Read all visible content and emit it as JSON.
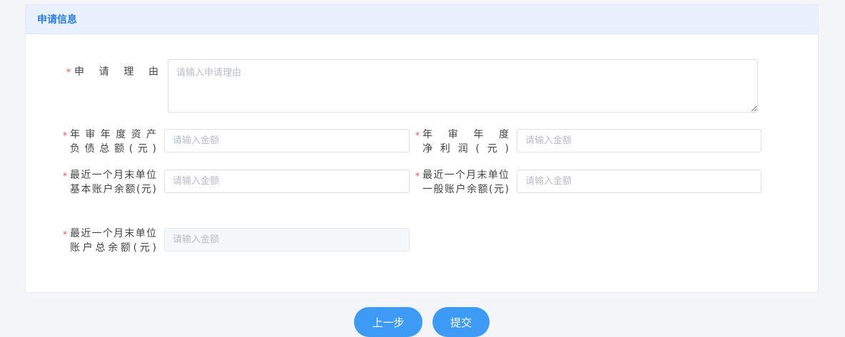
{
  "section": {
    "title": "申请信息"
  },
  "fields": {
    "reason": {
      "label": "申请理由",
      "placeholder": "请输入申请理由",
      "required_mark": "*"
    },
    "liability": {
      "label_line1": "年审年度资产",
      "label_line2": "负债总额(元)",
      "placeholder": "请输入金额",
      "required_mark": "*"
    },
    "profit": {
      "label_line1": "年审年度",
      "label_line2": "净利润(元)",
      "placeholder": "请输入金额",
      "required_mark": "*"
    },
    "basic_balance": {
      "label_line1": "最近一个月末单位",
      "label_line2": "基本账户余额(元)",
      "placeholder": "请输入金额",
      "required_mark": "*"
    },
    "general_balance": {
      "label_line1": "最近一个月末单位",
      "label_line2": "一般账户余额(元)",
      "placeholder": "请输入金额",
      "required_mark": "*"
    },
    "total_balance": {
      "label_line1": "最近一个月末单位",
      "label_line2": "账户总余额(元)",
      "placeholder": "请输入金额",
      "required_mark": "*"
    }
  },
  "actions": {
    "prev_label": "上一步",
    "submit_label": "提交"
  },
  "colors": {
    "accent": "#3d9bf5",
    "title": "#2e7ee0",
    "required": "#f04b4b"
  }
}
